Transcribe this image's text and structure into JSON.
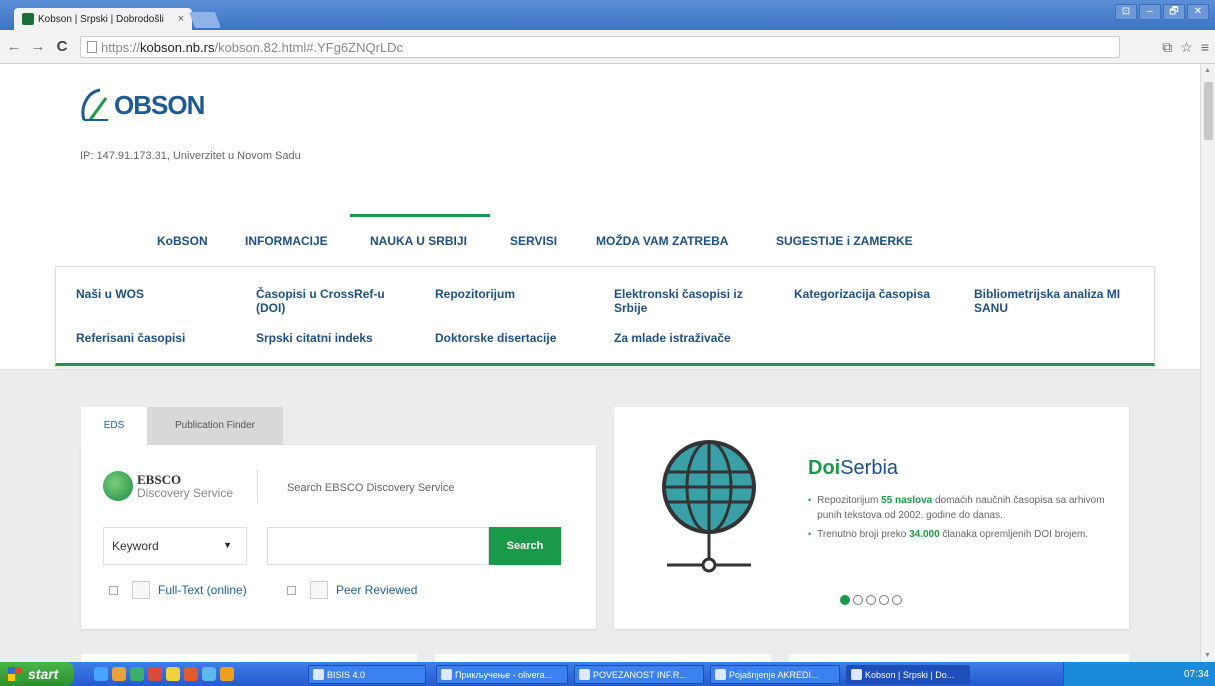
{
  "browser": {
    "tab_title": "Kobson | Srpski | Dobrodošli",
    "tab_close": "×",
    "url_prefix": "https://",
    "url_host": "kobson.nb.rs",
    "url_path": "/kobson.82.html#.YFg6ZNQrLDc",
    "window_buttons": [
      "⊡",
      "–",
      "🗗",
      "✕"
    ],
    "nav_back": "←",
    "nav_forward": "→",
    "nav_reload": "C",
    "toolbar_icons": [
      "⧉",
      "☆",
      "≡"
    ]
  },
  "site": {
    "logo_text": "OBSON",
    "ip_info": "IP: 147.91.173.31, Univerzitet u Novom Sadu",
    "brand_color": "#1a9a48",
    "link_color": "#1f4f87"
  },
  "mainnav": {
    "items": [
      "KoBSON",
      "INFORMACIJE",
      "NAUKA U SRBIJI",
      "SERVISI",
      "MOŽDA VAM ZATREBA",
      "SUGESTIJE i ZAMERKE"
    ],
    "active": "NAUKA U SRBIJI"
  },
  "submenu": {
    "row1": [
      "Naši u WOS",
      "Časopisi u CrossRef-u (DOI)",
      "Repozitorijum",
      "Elektronski časopisi iz Srbije",
      "Kategorizacija časopisa",
      "Bibliometrijska analiza MI SANU"
    ],
    "row2": [
      "Referisani časopisi",
      "Srpski citatni indeks",
      "Doktorske disertacije",
      "Za mlade istraživače"
    ]
  },
  "search": {
    "tabs": [
      "EDS",
      "Publication Finder"
    ],
    "ebsco_name": "EBSCO",
    "ebsco_sub": "Discovery Service",
    "caption": "Search EBSCO Discovery Service",
    "select_value": "Keyword",
    "select_caret": "▼",
    "input_value": "",
    "button": "Search",
    "checkbox1": "Full-Text (online)",
    "checkbox2": "Peer Reviewed"
  },
  "doiserbia": {
    "title_bold": "Doi",
    "title_rest": "Serbia",
    "bullet1_a": "Repozitorijum ",
    "bullet1_b": "55 naslova",
    "bullet1_c": " domaćih naučnih časopisa sa arhivom punih tekstova od 2002. godine do danas.",
    "bullet2_a": "Trenutno broji preko ",
    "bullet2_b": "34.000",
    "bullet2_c": " članaka opremljenih DOI brojem.",
    "bullet_mark": "•",
    "slide_active": 1,
    "slide_count": 5
  },
  "taskbar": {
    "start": "start",
    "items": [
      "BISIS 4.0",
      "Прикључење - olivera...",
      "POVEZANOST INF.R...",
      "Pojašnjenje AKREDI...",
      "Kobson | Srpski | Do..."
    ],
    "clock": "07:34"
  }
}
